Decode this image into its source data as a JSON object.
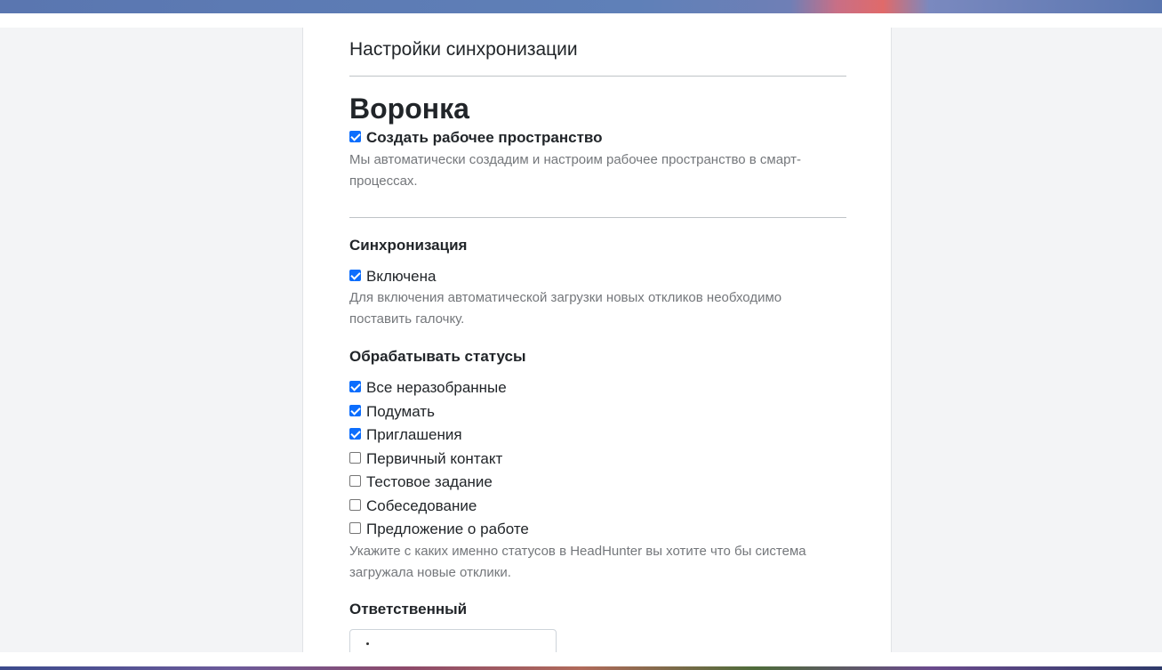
{
  "page": {
    "title": "Настройки синхронизации"
  },
  "funnel": {
    "heading": "Воронка",
    "create_workspace": {
      "label": "Создать рабочее пространство",
      "checked": true,
      "hint": "Мы автоматически создадим и настроим рабочее пространство в смарт-процессах."
    }
  },
  "sync": {
    "heading": "Синхронизация",
    "enabled": {
      "label": "Включена",
      "checked": true,
      "hint": "Для включения автоматической загрузки новых откликов необходимо поставить галочку."
    }
  },
  "statuses": {
    "heading": "Обрабатывать статусы",
    "items": [
      {
        "label": "Все неразобранные",
        "checked": true
      },
      {
        "label": "Подумать",
        "checked": true
      },
      {
        "label": "Приглашения",
        "checked": true
      },
      {
        "label": "Первичный контакт",
        "checked": false
      },
      {
        "label": "Тестовое задание",
        "checked": false
      },
      {
        "label": "Собеседование",
        "checked": false
      },
      {
        "label": "Предложение о работе",
        "checked": false
      }
    ],
    "hint": "Укажите с каких именно статусов в HeadHunter вы хотите что бы система загружала новые отклики."
  },
  "responsible": {
    "heading": "Ответственный"
  },
  "colors": {
    "accent": "#0d6efd",
    "hint_text": "#74777b",
    "page_bg": "#f3f4f6"
  }
}
